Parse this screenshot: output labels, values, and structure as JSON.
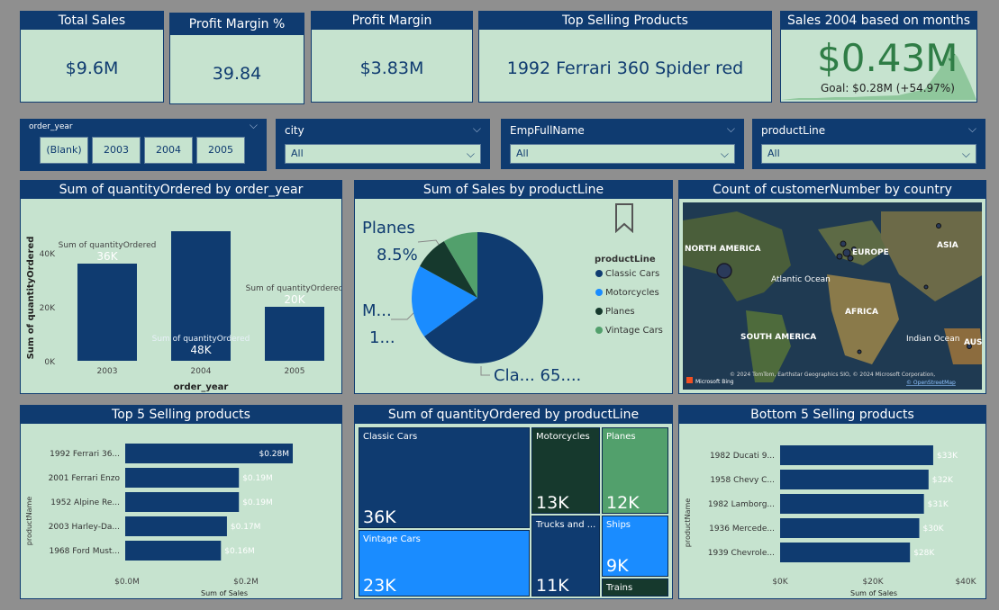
{
  "kpis": {
    "total_sales": {
      "title": "Total Sales",
      "value": "$9.6M"
    },
    "profit_margin_pct": {
      "title": "Profit Margin %",
      "value": "39.84"
    },
    "profit_margin": {
      "title": "Profit Margin",
      "value": "$3.83M"
    },
    "top_product": {
      "title": "Top Selling Products",
      "value": "1992 Ferrari 360 Spider red"
    },
    "sales_2004": {
      "title": "Sales 2004 based on months",
      "value": "$0.43M",
      "goal": "Goal: $0.28M (+54.97%)"
    }
  },
  "slicers": {
    "order_year": {
      "title": "order_year",
      "options": [
        "(Blank)",
        "2003",
        "2004",
        "2005"
      ]
    },
    "city": {
      "title": "city",
      "value": "All"
    },
    "emp": {
      "title": "EmpFullName",
      "value": "All"
    },
    "productline": {
      "title": "productLine",
      "value": "All"
    }
  },
  "charts": {
    "qty_by_year": {
      "title": "Sum of quantityOrdered by order_year",
      "xlabel": "order_year",
      "ylabel": "Sum of quantityOrdered",
      "yticks": [
        "40K",
        "20K",
        "0K"
      ],
      "series_label": "Sum of quantityOrdered"
    },
    "sales_by_line": {
      "title": "Sum of Sales by productLine",
      "legend_title": "productLine",
      "label_planes": "Planes",
      "label_planes_pct": "8.5%",
      "label_m": "M...",
      "label_m2": "1...",
      "label_cla": "Cla... 65...."
    },
    "customers_map": {
      "title": "Count of customerNumber by country",
      "labels": [
        "NORTH AMERICA",
        "EUROPE",
        "ASIA",
        "Atlantic Ocean",
        "AFRICA",
        "SOUTH AMERICA",
        "Indian Ocean",
        "AUS"
      ],
      "credit": "© 2024 TomTom, Earthstar Geographics SIO, © 2024 Microsoft Corporation,",
      "osm": "© OpenStreetMap",
      "bing": "Microsoft Bing"
    },
    "top5": {
      "title": "Top 5 Selling products",
      "ylabel": "productName",
      "xlabel": "Sum of Sales",
      "xticks": [
        "$0.0M",
        "$0.2M"
      ]
    },
    "qty_treemap": {
      "title": "Sum of quantityOrdered by productLine"
    },
    "bottom5": {
      "title": "Bottom 5 Selling products",
      "ylabel": "productName",
      "xlabel": "Sum of Sales",
      "xticks": [
        "$0K",
        "$20K",
        "$40K"
      ]
    }
  },
  "chart_data": [
    {
      "type": "bar",
      "title": "Sum of quantityOrdered by order_year",
      "categories": [
        "2003",
        "2004",
        "2005"
      ],
      "values": [
        36000,
        48000,
        20000
      ],
      "data_labels": [
        "36K",
        "48K",
        "20K"
      ],
      "xlabel": "order_year",
      "ylabel": "Sum of quantityOrdered",
      "ylim": [
        0,
        50000
      ],
      "color": "#0f3b70"
    },
    {
      "type": "pie",
      "title": "Sum of Sales by productLine",
      "labels": [
        "Classic Cars",
        "Motorcycles",
        "Planes",
        "Vintage Cars"
      ],
      "values": [
        65,
        18,
        8.5,
        8.5
      ],
      "colors": [
        "#0f3b70",
        "#1a8cff",
        "#16392d",
        "#52a06c"
      ],
      "legend": "right"
    },
    {
      "type": "bar",
      "title": "Top 5 Selling products",
      "categories": [
        "1992 Ferrari 36...",
        "2001 Ferrari Enzo",
        "1952 Alpine Re...",
        "2003 Harley-Da...",
        "1968 Ford Must..."
      ],
      "values": [
        0.28,
        0.19,
        0.19,
        0.17,
        0.16
      ],
      "data_labels": [
        "$0.28M",
        "$0.19M",
        "$0.19M",
        "$0.17M",
        "$0.16M"
      ],
      "xlim": [
        0,
        0.28
      ],
      "orientation": "horizontal"
    },
    {
      "type": "heatmap",
      "title": "Sum of quantityOrdered by productLine",
      "labels": [
        "Classic Cars",
        "Vintage Cars",
        "Motorcycles",
        "Planes",
        "Trucks and ...",
        "Ships",
        "Trains"
      ],
      "values": [
        "36K",
        "23K",
        "13K",
        "12K",
        "11K",
        "9K",
        ""
      ]
    },
    {
      "type": "bar",
      "title": "Bottom 5 Selling products",
      "categories": [
        "1982 Ducati 9...",
        "1958 Chevy C...",
        "1982 Lamborg...",
        "1936 Mercede...",
        "1939 Chevrole..."
      ],
      "values": [
        33,
        32,
        31,
        30,
        28
      ],
      "data_labels": [
        "$33K",
        "$32K",
        "$31K",
        "$30K",
        "$28K"
      ],
      "xlim": [
        0,
        40
      ],
      "orientation": "horizontal"
    }
  ]
}
